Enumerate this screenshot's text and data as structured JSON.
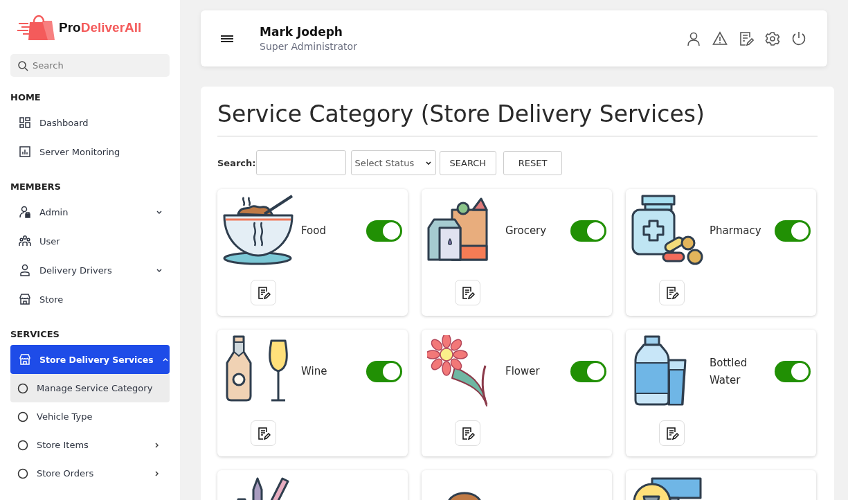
{
  "brand": {
    "part_1": "Pro",
    "part_2": "DeliverAll"
  },
  "sidebar": {
    "search": {
      "placeholder": "Search"
    },
    "sections": [
      {
        "title": "HOME",
        "items": [
          {
            "label": "Dashboard",
            "kind": "dashboard",
            "selected": false
          },
          {
            "label": "Server Monitoring",
            "kind": "chart",
            "selected": false
          }
        ]
      },
      {
        "title": "MEMBERS",
        "items": [
          {
            "label": "Admin",
            "kind": "admin",
            "selected": false,
            "expandable": true,
            "expanded": false
          },
          {
            "label": "User",
            "kind": "users",
            "selected": false
          },
          {
            "label": "Delivery Drivers",
            "kind": "driver",
            "selected": false,
            "expandable": true,
            "expanded": false
          },
          {
            "label": "Store",
            "kind": "store",
            "selected": false
          }
        ]
      },
      {
        "title": "SERVICES",
        "items": [
          {
            "label": "Store Delivery Services",
            "kind": "store",
            "selected": true,
            "expandable": true,
            "expanded": true,
            "children": [
              {
                "label": "Manage Service Category",
                "selected": true,
                "submenu": false
              },
              {
                "label": "Vehicle Type",
                "selected": false,
                "submenu": false
              },
              {
                "label": "Store Items",
                "selected": false,
                "submenu": true
              },
              {
                "label": "Store Orders",
                "selected": false,
                "submenu": true
              }
            ]
          }
        ]
      }
    ]
  },
  "header": {
    "user_name": "Mark Jodeph",
    "user_role": "Super Administrator"
  },
  "page": {
    "title": "Service Category (Store Delivery Services)",
    "filter": {
      "search_label": "Search:",
      "status_placeholder": "Select Status",
      "search_button": "SEARCH",
      "reset_button": "RESET"
    },
    "categories": [
      {
        "name": "Food",
        "kind": "food",
        "on": true
      },
      {
        "name": "Grocery",
        "kind": "grocery",
        "on": true
      },
      {
        "name": "Pharmacy",
        "kind": "pharmacy",
        "on": true
      },
      {
        "name": "Wine",
        "kind": "wine",
        "on": true
      },
      {
        "name": "Flower",
        "kind": "flower",
        "on": true
      },
      {
        "name": "Bottled Water",
        "kind": "water",
        "on": true
      },
      {
        "kind": "stationery"
      },
      {
        "kind": "spice"
      },
      {
        "kind": "shop"
      }
    ]
  }
}
